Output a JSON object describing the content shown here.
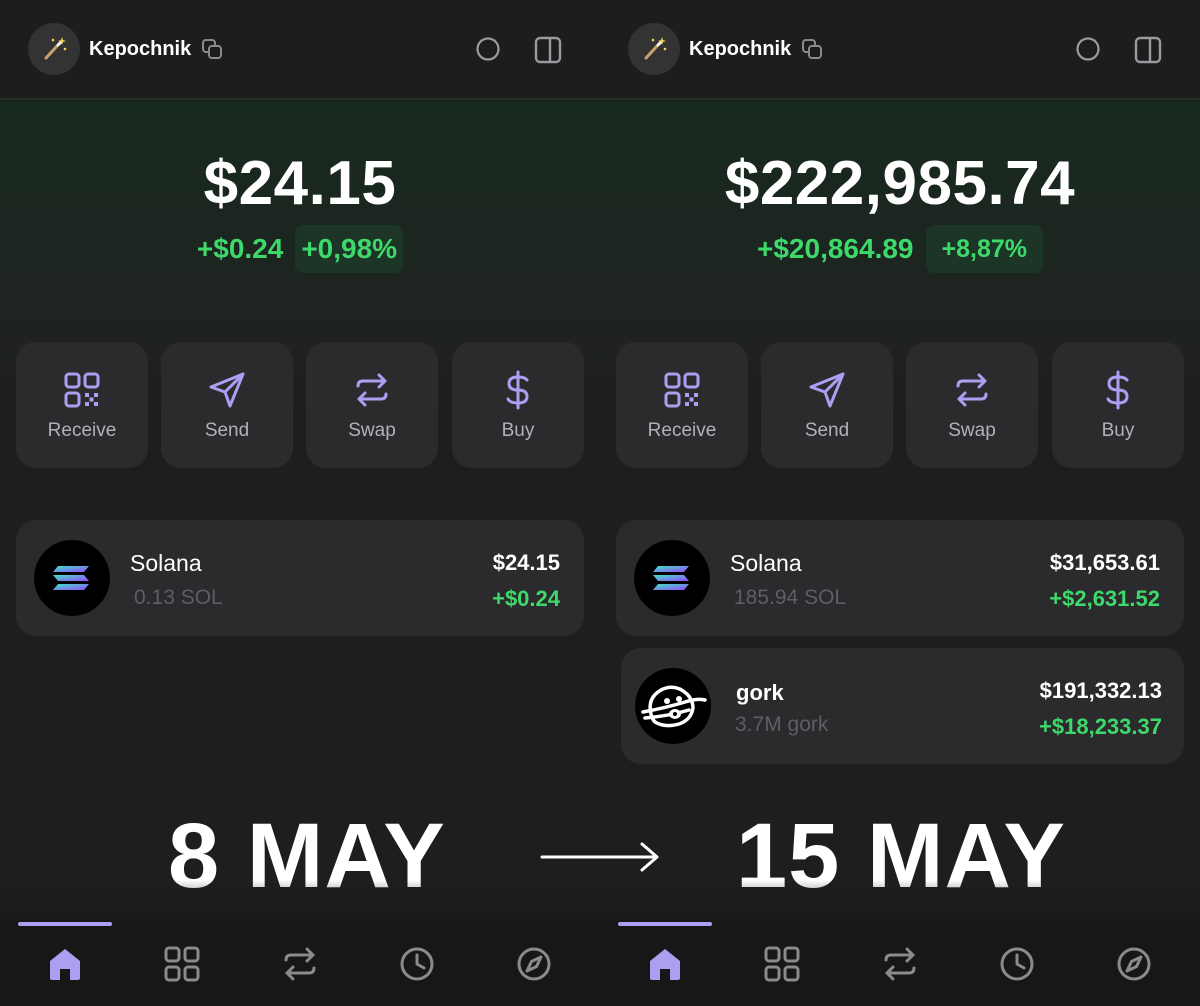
{
  "colors": {
    "accent": "#ab9ff2",
    "positive": "#3dd96b",
    "card": "#2b2b2e",
    "muted_text": "#5e5e63"
  },
  "actions": [
    {
      "label": "Receive",
      "icon": "qr-code-icon"
    },
    {
      "label": "Send",
      "icon": "send-icon"
    },
    {
      "label": "Swap",
      "icon": "swap-icon"
    },
    {
      "label": "Buy",
      "icon": "dollar-icon"
    }
  ],
  "nav": [
    "home-icon",
    "collectibles-grid-icon",
    "swap-icon",
    "history-clock-icon",
    "explore-compass-icon"
  ],
  "left": {
    "account_name": "Kepochnik",
    "balance": "$24.15",
    "change_amount": "+$0.24",
    "change_pct": "+0,98%",
    "tokens": [
      {
        "name": "Solana",
        "amount": "0.13 SOL",
        "value": "$24.15",
        "change": "+$0.24",
        "logo": "solana-logo-icon"
      }
    ],
    "date_label": "8 MAY"
  },
  "right": {
    "account_name": "Kepochnik",
    "balance": "$222,985.74",
    "change_amount": "+$20,864.89",
    "change_pct": "+8,87%",
    "tokens": [
      {
        "name": "Solana",
        "amount": "185.94 SOL",
        "value": "$31,653.61",
        "change": "+$2,631.52",
        "logo": "solana-logo-icon"
      },
      {
        "name": "gork",
        "amount": "3.7M gork",
        "value": "$191,332.13",
        "change": "+$18,233.37",
        "logo": "gork-logo-icon"
      }
    ],
    "date_label": "15 MAY"
  }
}
